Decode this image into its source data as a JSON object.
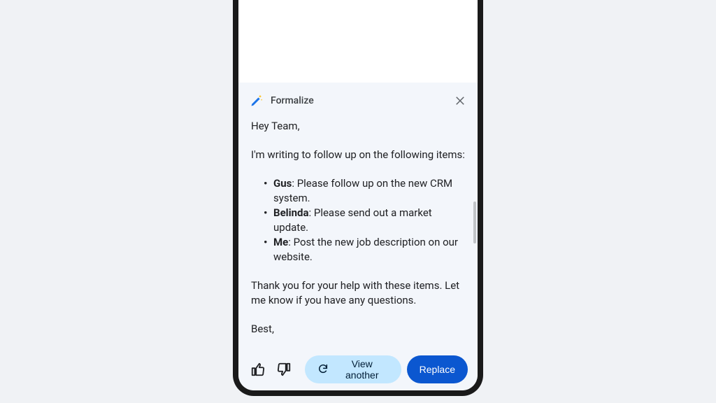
{
  "panel": {
    "title": "Formalize"
  },
  "message": {
    "greeting": "Hey Team,",
    "intro": "I'm writing to follow up on the following items:",
    "items": [
      {
        "name": "Gus",
        "task": ": Please follow up on the new CRM system."
      },
      {
        "name": "Belinda",
        "task": ": Please send out a market update."
      },
      {
        "name": "Me",
        "task": ": Post the new job description on our website."
      }
    ],
    "thanks": "Thank you for your help with these items. Let me know if you have any questions.",
    "signoff": "Best,"
  },
  "footer": {
    "view_another": "View another",
    "replace": "Replace"
  }
}
